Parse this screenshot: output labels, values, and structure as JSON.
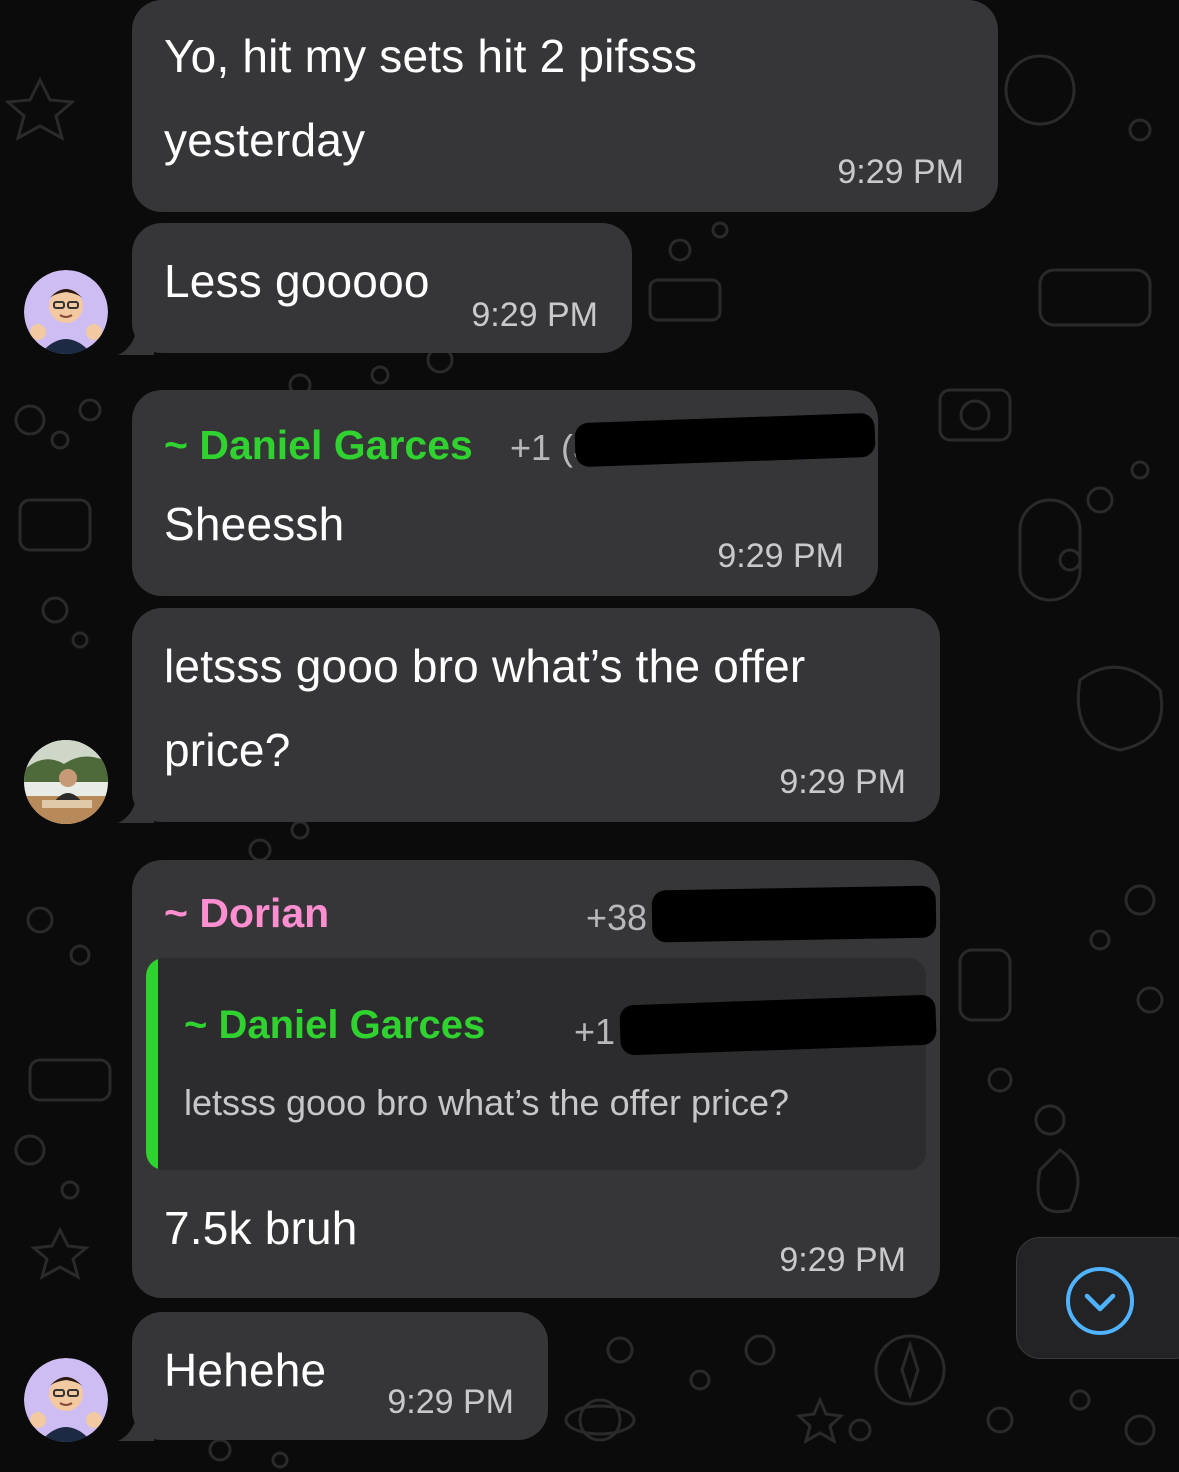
{
  "messages": [
    {
      "text_line1": "Yo, hit my sets hit 2 pifsss",
      "text_line2": "yesterday",
      "time": "9:29 PM"
    },
    {
      "text": "Less gooooo",
      "time": "9:29 PM"
    },
    {
      "sender": "~ Daniel Garces",
      "phone": "+1 (30",
      "text": "Sheessh",
      "time": "9:29 PM"
    },
    {
      "text_line1": "letsss gooo bro what’s the offer",
      "text_line2": "price?",
      "time": "9:29 PM"
    },
    {
      "sender": "~ Dorian",
      "phone": "+38",
      "quote": {
        "sender": "~ Daniel Garces",
        "phone": "+1 (",
        "text": "letsss gooo bro what’s the offer price?"
      },
      "text": "7.5k bruh",
      "time": "9:29 PM"
    },
    {
      "text": "Hehehe",
      "time": "9:29 PM"
    }
  ],
  "icons": {
    "scroll_down": "chevron-down-circle-icon"
  },
  "colors": {
    "bubble": "#363638",
    "daniel_name": "#2fd22f",
    "dorian_name": "#ff8fd0",
    "accent": "#4fb3ff"
  }
}
